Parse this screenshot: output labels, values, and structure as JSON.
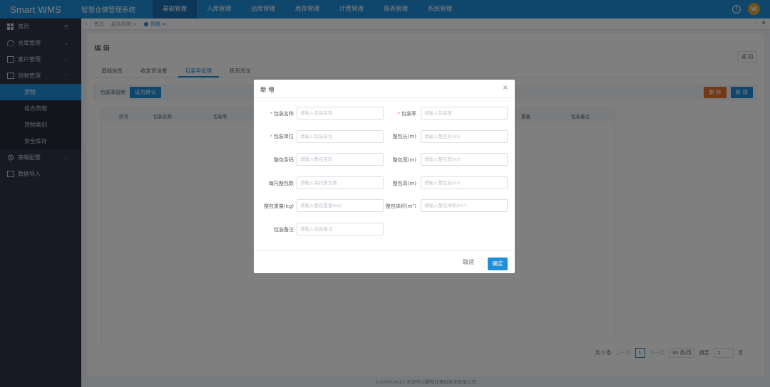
{
  "topbar": {
    "brand": "Smart WMS",
    "system_name": "智慧仓储管理系统",
    "nav": [
      "基础管理",
      "入库管理",
      "出库管理",
      "库存管理",
      "计费管理",
      "报表管理",
      "系统管理"
    ],
    "help_icon": "?",
    "avatar_letter": "W",
    "accent": "#1f8fd9"
  },
  "sidebar": {
    "home": "首页",
    "warehouse": "仓库管理",
    "customer": "客户管理",
    "goods_mgmt": "货物管理",
    "goods_sub": [
      "货物",
      "组合货物",
      "货物类别",
      "安全库存"
    ],
    "strategy": "策略配置",
    "import": "数据导入"
  },
  "tabbar": {
    "tabs": [
      "首页",
      "组合货物",
      "货物"
    ]
  },
  "page": {
    "title": "编 辑",
    "corner_btn": "返 回",
    "subtabs": [
      "基础信息",
      "收发货设置",
      "包装率管理",
      "拣货库位"
    ],
    "toolbar_label": "包装率管理",
    "set_default_btn": "设为默认",
    "delete_btn": "删 除",
    "add_btn": "新 增",
    "table_headers": [
      "序号",
      "包装名称",
      "包装率",
      "重量",
      "包装备注"
    ]
  },
  "pager": {
    "total": "共 0 条",
    "prev": "上一页",
    "current": "1",
    "next": "下一页",
    "page_size": "30 条/页",
    "goto": "跳至",
    "goto_value": "1",
    "page_unit": "页"
  },
  "footer": "©2005-2021 天津市小脚鸭计算机技术有限公司",
  "modal": {
    "title": "新 增",
    "close": "×",
    "fields": {
      "name_label": "包装名称",
      "name_ph": "请输入包装名称",
      "rate_label": "包装率",
      "rate_ph": "请输入包装率",
      "unit_label": "包装单位",
      "unit_ph": "请输入包装单位",
      "length_label": "整包长(m)",
      "length_ph": "请输入整包长(m)",
      "barcode_label": "整包条码",
      "barcode_ph": "请输入整包条码",
      "width_label": "整包宽(m)",
      "width_ph": "请输入整包宽(m)",
      "pallet_label": "每托整包数",
      "pallet_ph": "请输入每托整包数",
      "height_label": "整包高(m)",
      "height_ph": "请输入整包高(m)",
      "weight_label": "整包重量(kg)",
      "weight_ph": "请输入整包重量(kg)",
      "volume_label": "整包体积(m³)",
      "volume_ph": "请输入整包体积(m³)",
      "remark_label": "包装备注",
      "remark_ph": "请输入包装备注"
    },
    "cancel": "取消",
    "confirm": "确定"
  }
}
